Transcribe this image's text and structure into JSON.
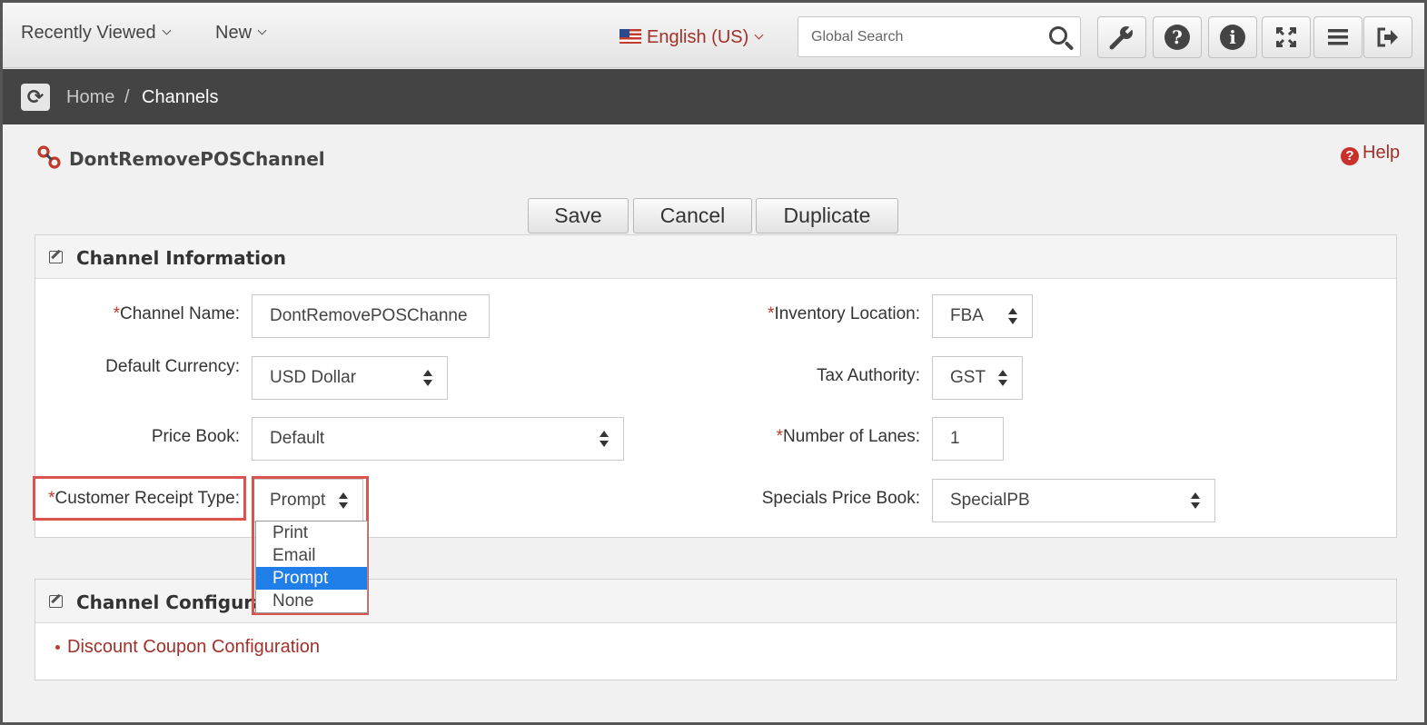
{
  "topbar": {
    "recently_viewed": "Recently Viewed",
    "new": "New",
    "language": "English (US)",
    "search_placeholder": "Global Search",
    "icons": [
      "wrench-icon",
      "help-icon",
      "info-icon",
      "fullscreen-icon",
      "menu-icon",
      "logout-icon"
    ]
  },
  "breadcrumb": {
    "home": "Home",
    "separator": "/",
    "current": "Channels"
  },
  "page": {
    "title": "DontRemovePOSChannel",
    "help": "Help"
  },
  "actions": {
    "save": "Save",
    "cancel": "Cancel",
    "duplicate": "Duplicate"
  },
  "channel_info": {
    "header": "Channel Information",
    "required_mark": "*",
    "channel_name_label": "Channel Name:",
    "channel_name_value": "DontRemovePOSChanne",
    "default_currency_label": "Default Currency:",
    "default_currency_value": "USD Dollar",
    "price_book_label": "Price Book:",
    "price_book_value": "Default",
    "receipt_type_label": "Customer Receipt Type:",
    "receipt_type_value": "Prompt",
    "receipt_type_options": [
      "Print",
      "Email",
      "Prompt",
      "None"
    ],
    "inventory_location_label": "Inventory Location:",
    "inventory_location_value": "FBA",
    "tax_authority_label": "Tax Authority:",
    "tax_authority_value": "GST",
    "lanes_label": "Number of Lanes:",
    "lanes_value": "1",
    "specials_label": "Specials Price Book:",
    "specials_value": "SpecialPB"
  },
  "channel_config": {
    "header": "Channel Configuration",
    "link": "Discount Coupon Configuration"
  },
  "colors": {
    "accent": "#a0302a",
    "highlight": "#d9534f",
    "selected": "#1f7ee8",
    "topbar_dark": "#444444"
  }
}
